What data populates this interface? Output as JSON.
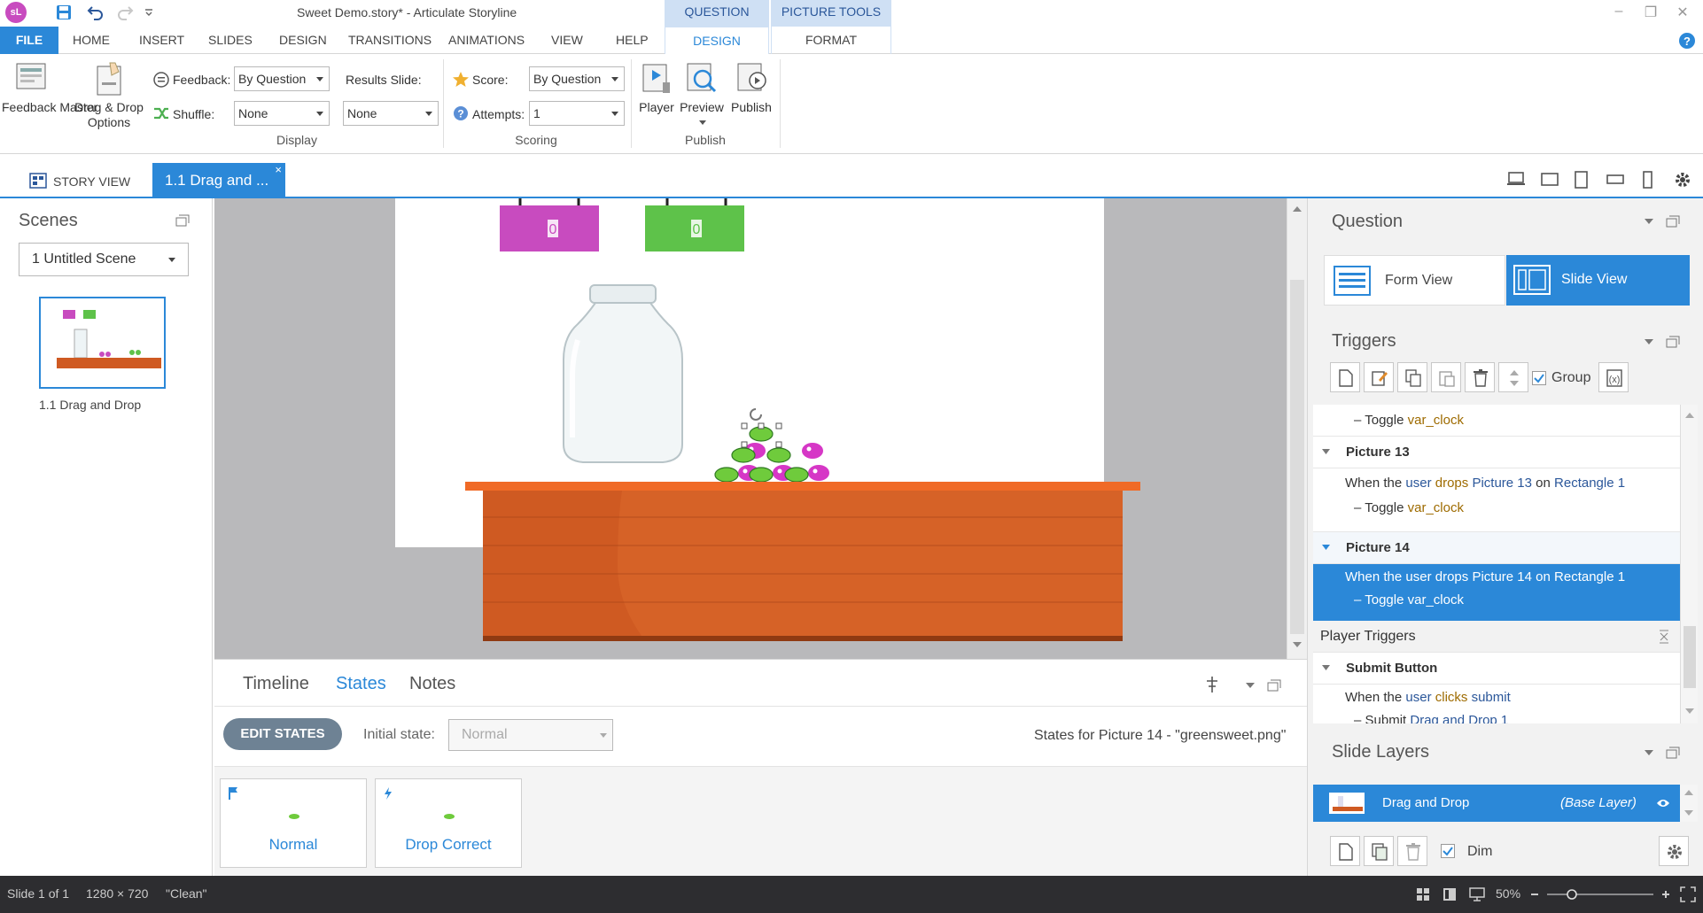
{
  "app": {
    "title": "Sweet Demo.story* - Articulate Storyline",
    "logo": "sL",
    "context_tabs": [
      {
        "label": "QUESTION TOOLS"
      },
      {
        "label": "PICTURE TOOLS"
      }
    ]
  },
  "ribbon_tabs": [
    {
      "label": "FILE"
    },
    {
      "label": "HOME"
    },
    {
      "label": "INSERT"
    },
    {
      "label": "SLIDES"
    },
    {
      "label": "DESIGN"
    },
    {
      "label": "TRANSITIONS"
    },
    {
      "label": "ANIMATIONS"
    },
    {
      "label": "VIEW"
    },
    {
      "label": "HELP"
    },
    {
      "label": "DESIGN"
    },
    {
      "label": "FORMAT"
    }
  ],
  "ribbon": {
    "feedback_master": "Feedback Master",
    "drag_drop_options_1": "Drag & Drop",
    "drag_drop_options_2": "Options",
    "feedback_label": "Feedback:",
    "feedback_value": "By Question",
    "shuffle_label": "Shuffle:",
    "shuffle_value": "None",
    "results_slide_label": "Results Slide:",
    "results_slide_value": "None",
    "display_group": "Display",
    "score_label": "Score:",
    "score_value": "By Question",
    "attempts_label": "Attempts:",
    "attempts_value": "1",
    "scoring_group": "Scoring",
    "player": "Player",
    "preview": "Preview",
    "publish": "Publish",
    "publish_group": "Publish"
  },
  "docbar": {
    "story_view": "STORY VIEW",
    "slide_tab": "1.1 Drag and ...",
    "close": "×"
  },
  "scenes": {
    "title": "Scenes",
    "scene_select": "1 Untitled Scene",
    "slide_label": "1.1 Drag and Drop"
  },
  "slide": {
    "counter_pink": "0",
    "counter_green": "0",
    "colors": {
      "pink": "#c84bbf",
      "green": "#5ec24a",
      "table": "#cf5a22",
      "table_top": "#f06a26"
    }
  },
  "bottom": {
    "tabs": [
      {
        "label": "Timeline"
      },
      {
        "label": "States"
      },
      {
        "label": "Notes"
      }
    ],
    "edit_states": "EDIT STATES",
    "initial_state_label": "Initial state:",
    "initial_state_value": "Normal",
    "states_for": "States for Picture 14 - \"greensweet.png\"",
    "states": [
      {
        "label": "Normal"
      },
      {
        "label": "Drop Correct"
      }
    ]
  },
  "question_panel": {
    "title": "Question",
    "form_view": "Form View",
    "slide_view": "Slide View"
  },
  "triggers_panel": {
    "title": "Triggers",
    "group_label": "Group",
    "dash": "–",
    "toggle": "Toggle",
    "var": "var_clock",
    "picture13": "Picture 13",
    "picture14": "Picture 14",
    "when_user": "When the",
    "user": "user",
    "drops": "drops",
    "on": "on",
    "rect": "Rectangle 1",
    "player_triggers": "Player Triggers",
    "submit_button": "Submit Button",
    "clicks": "clicks",
    "submit": "submit",
    "submit_verb": "Submit",
    "drag_and_drop_1": "Drag and Drop 1"
  },
  "layers_panel": {
    "title": "Slide Layers",
    "layer_name": "Drag and Drop",
    "layer_base": "(Base Layer)",
    "dim_label": "Dim"
  },
  "status_bar": {
    "slide": "Slide 1 of 1",
    "size": "1280 × 720",
    "theme": "\"Clean\"",
    "zoom": "50%"
  }
}
